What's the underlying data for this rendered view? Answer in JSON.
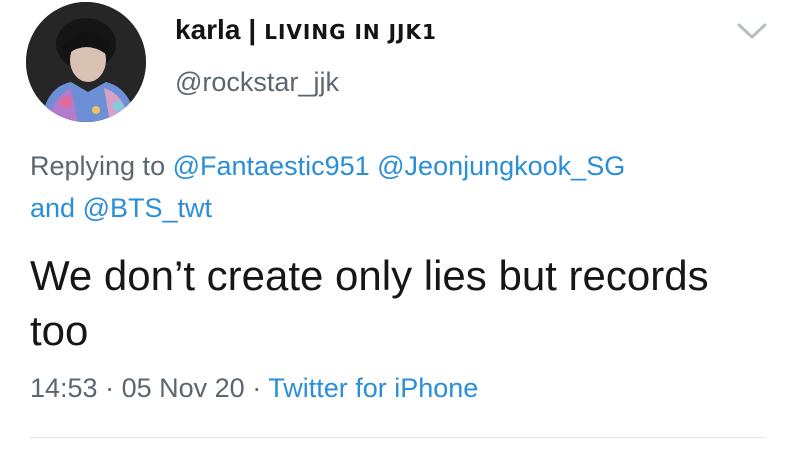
{
  "author": {
    "display_name": "karla",
    "separator": "|",
    "name_tag": "LIVING IN JJK1",
    "handle": "@rockstar_jjk"
  },
  "reply": {
    "prefix": "Replying to",
    "mentions": [
      "@Fantaestic951",
      "@Jeonjungkook_SG",
      "@BTS_twt"
    ],
    "conjunction": "and"
  },
  "tweet": {
    "text": "We don’t create only lies but records too"
  },
  "meta": {
    "time": "14:53",
    "dot": "·",
    "date": "05 Nov 20",
    "source": "Twitter for iPhone"
  },
  "icons": {
    "menu": "chevron-down-icon",
    "avatar": "profile-photo"
  },
  "colors": {
    "link": "#2a8ed8",
    "secondary_text": "#5b6770",
    "primary_text": "#141414",
    "divider": "#e1e5e8"
  }
}
